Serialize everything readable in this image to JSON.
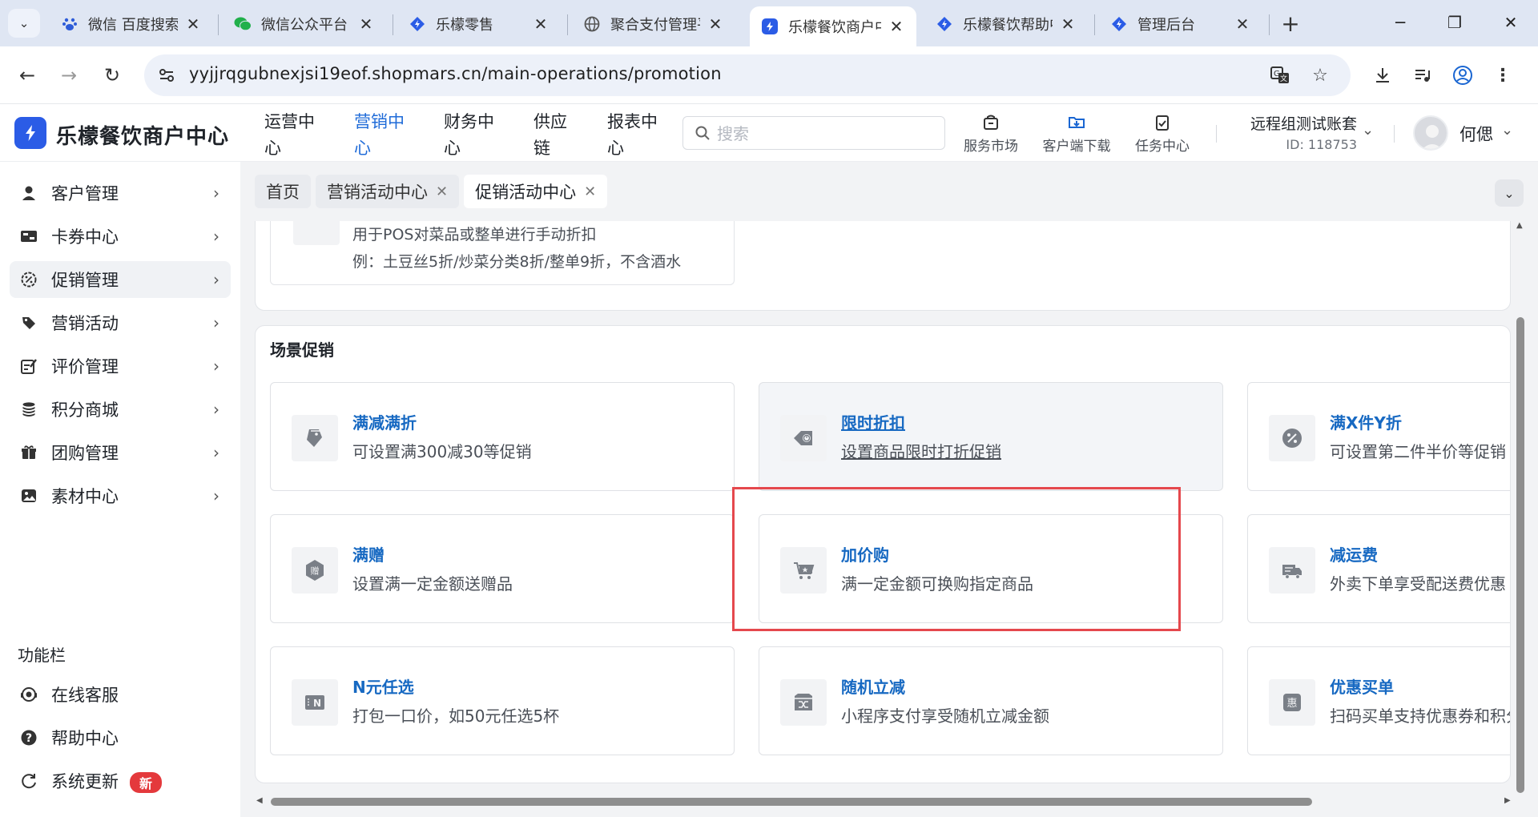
{
  "browser": {
    "tabs": [
      {
        "title": "微信 百度搜索",
        "icon": "baidu-paw-icon"
      },
      {
        "title": "微信公众平台",
        "icon": "wechat-icon"
      },
      {
        "title": "乐檬零售",
        "icon": "lemeng-diamond-icon"
      },
      {
        "title": "聚合支付管理平台",
        "icon": "globe-icon"
      },
      {
        "title": "乐檬餐饮商户中心",
        "icon": "lemeng-square-icon"
      },
      {
        "title": "乐檬餐饮帮助中心",
        "icon": "lemeng-diamond-icon"
      },
      {
        "title": "管理后台",
        "icon": "lemeng-diamond-icon"
      }
    ],
    "url": "yyjjrqgubnexjsi19eof.shopmars.cn/main-operations/promotion"
  },
  "header": {
    "logo_text": "乐檬餐饮商户中心",
    "nav": [
      {
        "label": "运营中心"
      },
      {
        "label": "营销中心"
      },
      {
        "label": "财务中心"
      },
      {
        "label": "供应链"
      },
      {
        "label": "报表中心"
      }
    ],
    "search_placeholder": "搜索",
    "tools": [
      {
        "label": "服务市场"
      },
      {
        "label": "客户端下载"
      },
      {
        "label": "任务中心"
      }
    ],
    "account_name": "远程组测试账套",
    "account_id": "ID: 118753",
    "user_name": "何偲"
  },
  "sidebar": {
    "items": [
      {
        "label": "客户管理"
      },
      {
        "label": "卡券中心"
      },
      {
        "label": "促销管理"
      },
      {
        "label": "营销活动"
      },
      {
        "label": "评价管理"
      },
      {
        "label": "积分商城"
      },
      {
        "label": "团购管理"
      },
      {
        "label": "素材中心"
      }
    ],
    "section_title": "功能栏",
    "functions": [
      {
        "label": "在线客服"
      },
      {
        "label": "帮助中心"
      },
      {
        "label": "系统更新"
      }
    ],
    "new_badge": "新"
  },
  "page_tabs": [
    {
      "label": "首页"
    },
    {
      "label": "营销活动中心"
    },
    {
      "label": "促销活动中心"
    }
  ],
  "top_card": {
    "line1": "用于POS对菜品或整单进行手动折扣",
    "line2": "例：土豆丝5折/炒菜分类8折/整单9折，不含酒水"
  },
  "scene": {
    "title": "场景促销",
    "items": [
      {
        "title": "满减满折",
        "desc": "可设置满300减30等促销",
        "icon": "tag-icon"
      },
      {
        "title": "限时折扣",
        "desc": "设置商品限时打折促销",
        "icon": "clock-tag-icon"
      },
      {
        "title": "满X件Y折",
        "desc": "可设置第二件半价等促销",
        "icon": "percent-icon"
      },
      {
        "title": "满赠",
        "desc": "设置满一定金额送赠品",
        "icon": "gift-hexagon-icon"
      },
      {
        "title": "加价购",
        "desc": "满一定金额可换购指定商品",
        "icon": "cart-icon"
      },
      {
        "title": "减运费",
        "desc": "外卖下单享受配送费优惠",
        "icon": "delivery-truck-icon"
      },
      {
        "title": "N元任选",
        "desc": "打包一口价，如50元任选5杯",
        "icon": "n-choice-icon"
      },
      {
        "title": "随机立减",
        "desc": "小程序支付享受随机立减金额",
        "icon": "shuffle-icon"
      },
      {
        "title": "优惠买单",
        "desc": "扫码买单支持优惠券和积分",
        "icon": "discount-hui-icon"
      }
    ]
  },
  "colors": {
    "brand_blue": "#2b5ce6",
    "link_blue": "#1769c2",
    "highlight_red": "#e5484d",
    "badge_red": "#e4393c"
  }
}
